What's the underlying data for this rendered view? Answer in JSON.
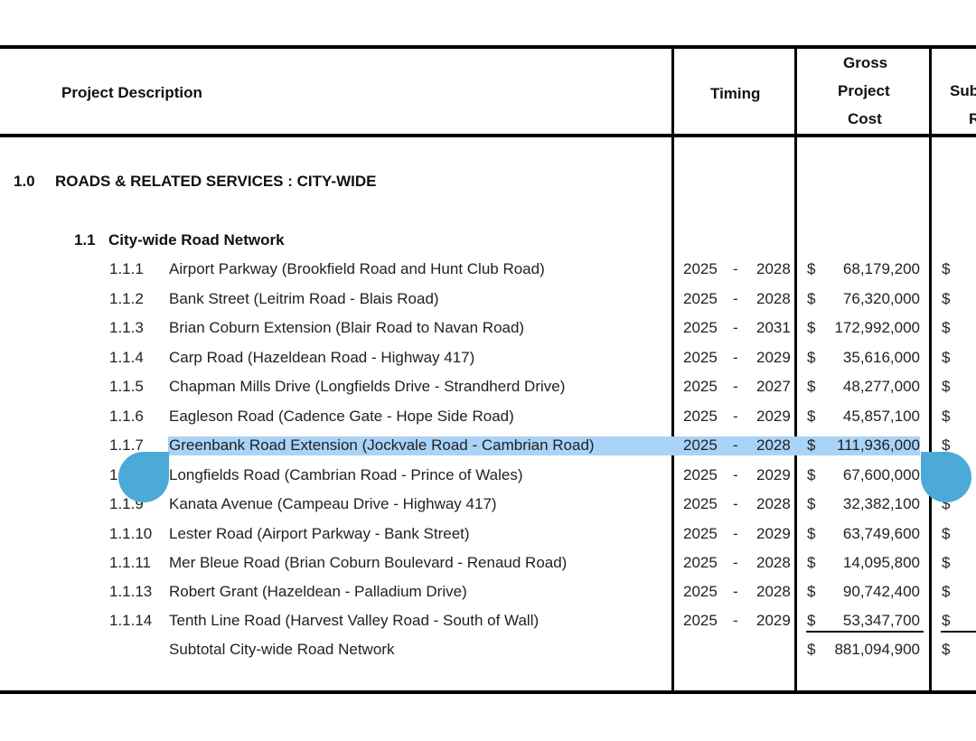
{
  "table_header": {
    "project_description": "Project Description",
    "timing": "Timing",
    "gross_line1": "Gross",
    "gross_line2": "Project",
    "gross_line3": "Cost",
    "sub_line1": "Sub",
    "sub_line2": "R"
  },
  "section": {
    "number": "1.0",
    "title": "ROADS & RELATED SERVICES : CITY-WIDE"
  },
  "subsection": {
    "number": "1.1",
    "title": "City-wide Road Network"
  },
  "currency_symbol": "$",
  "dash": "-",
  "rows": [
    {
      "num": "1.1.1",
      "desc": "Airport Parkway (Brookfield Road and Hunt Club Road)",
      "from": "2025",
      "to": "2028",
      "cost": "68,179,200"
    },
    {
      "num": "1.1.2",
      "desc": "Bank Street (Leitrim Road - Blais Road)",
      "from": "2025",
      "to": "2028",
      "cost": "76,320,000"
    },
    {
      "num": "1.1.3",
      "desc": "Brian Coburn Extension (Blair Road to Navan Road)",
      "from": "2025",
      "to": "2031",
      "cost": "172,992,000"
    },
    {
      "num": "1.1.4",
      "desc": "Carp Road (Hazeldean Road - Highway 417)",
      "from": "2025",
      "to": "2029",
      "cost": "35,616,000"
    },
    {
      "num": "1.1.5",
      "desc": "Chapman Mills Drive (Longfields Drive - Strandherd Drive)",
      "from": "2025",
      "to": "2027",
      "cost": "48,277,000"
    },
    {
      "num": "1.1.6",
      "desc": "Eagleson Road (Cadence Gate - Hope Side Road)",
      "from": "2025",
      "to": "2029",
      "cost": "45,857,100"
    },
    {
      "num": "1.1.7",
      "desc": "Greenbank Road Extension (Jockvale Road - Cambrian Road)",
      "from": "2025",
      "to": "2028",
      "cost": "111,936,000",
      "selected": true
    },
    {
      "num": "1.1.8",
      "desc": "Longfields Road (Cambrian Road - Prince of Wales)",
      "from": "2025",
      "to": "2029",
      "cost": "67,600,000"
    },
    {
      "num": "1.1.9",
      "desc": "Kanata Avenue (Campeau Drive - Highway 417)",
      "from": "2025",
      "to": "2028",
      "cost": "32,382,100"
    },
    {
      "num": "1.1.10",
      "desc": "Lester Road (Airport Parkway - Bank Street)",
      "from": "2025",
      "to": "2029",
      "cost": "63,749,600"
    },
    {
      "num": "1.1.11",
      "desc": "Mer Bleue Road (Brian Coburn Boulevard - Renaud Road)",
      "from": "2025",
      "to": "2028",
      "cost": "14,095,800"
    },
    {
      "num": "1.1.13",
      "desc": "Robert Grant (Hazeldean - Palladium Drive)",
      "from": "2025",
      "to": "2028",
      "cost": "90,742,400"
    },
    {
      "num": "1.1.14",
      "desc": "Tenth Line Road (Harvest Valley Road - South of Wall)",
      "from": "2025",
      "to": "2029",
      "cost": "53,347,700",
      "underlined": true
    }
  ],
  "subtotal": {
    "label": "Subtotal City-wide Road Network",
    "cost": "881,094,900"
  },
  "colors": {
    "selection_highlight": "#a9d3f7",
    "selection_handle": "#4caad8"
  }
}
